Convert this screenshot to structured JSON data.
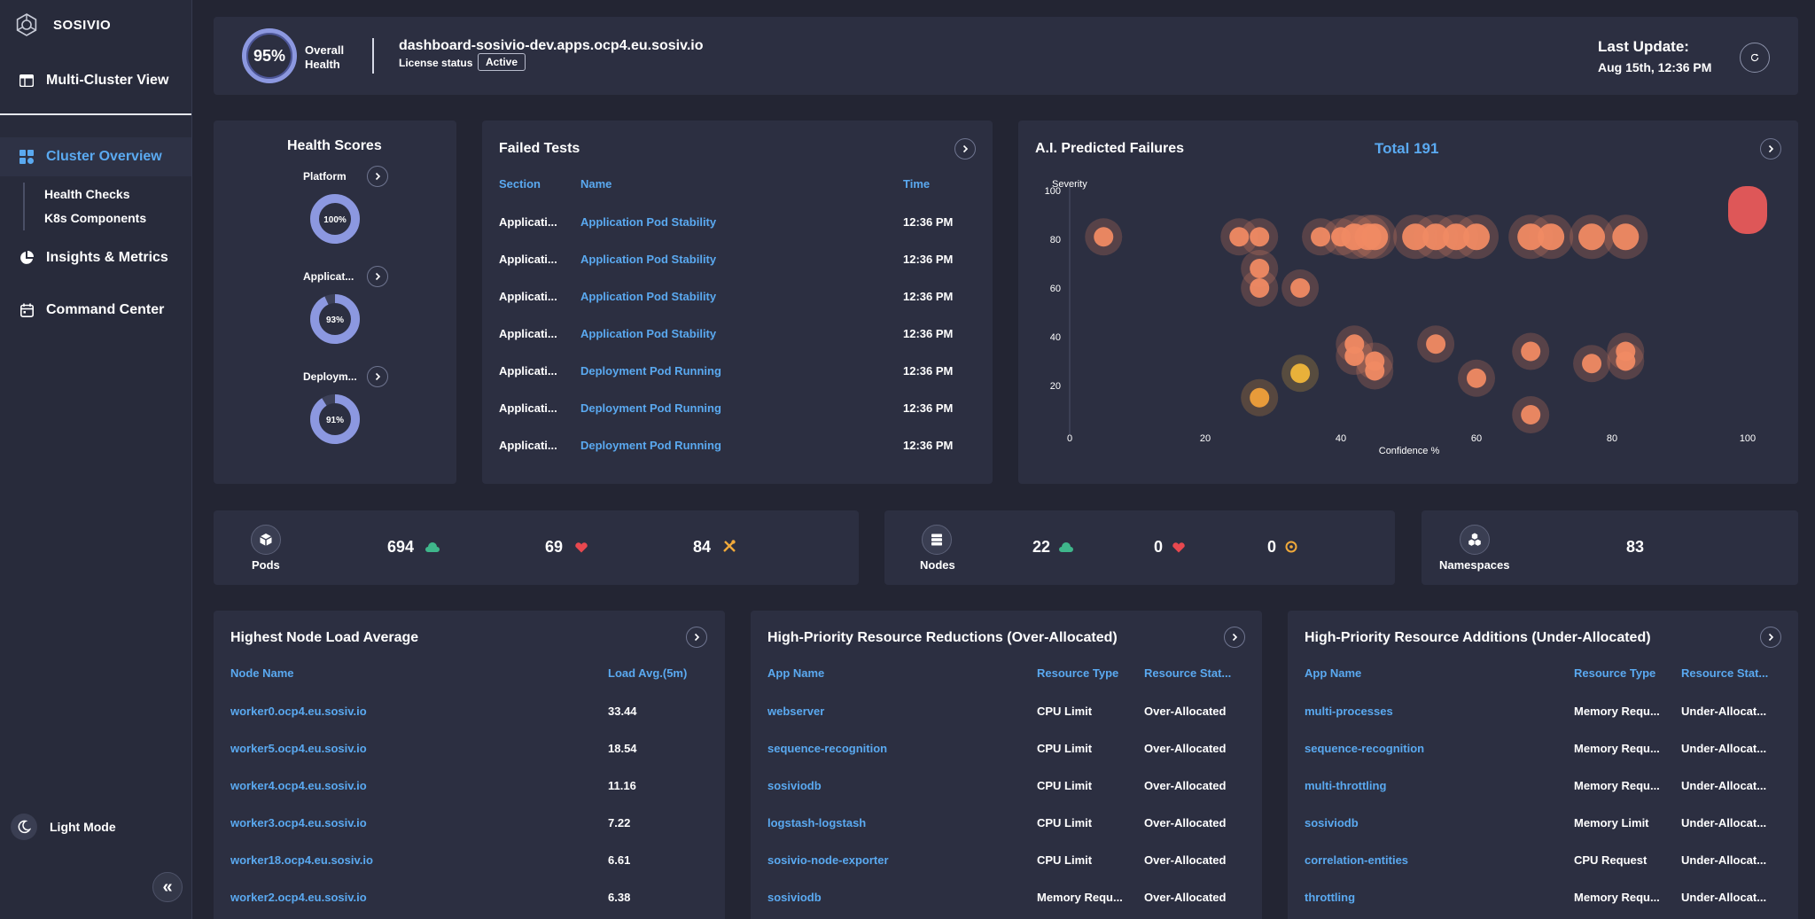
{
  "brand": {
    "name": "SOSIVIO"
  },
  "sidebar": {
    "multi_cluster": "Multi-Cluster View",
    "cluster_overview": "Cluster Overview",
    "sub": [
      "Health Checks",
      "K8s Components"
    ],
    "insights": "Insights & Metrics",
    "command_center": "Command Center",
    "light_mode": "Light Mode",
    "collapse": "«"
  },
  "header": {
    "health_pct": "95%",
    "overall": "Overall",
    "health": "Health",
    "host": "dashboard-sosivio-dev.apps.ocp4.eu.sosiv.io",
    "license_label": "License status",
    "license_value": "Active",
    "last_update_label": "Last Update:",
    "last_update_value": "Aug 15th, 12:36 PM"
  },
  "health_scores": {
    "title": "Health Scores",
    "items": [
      {
        "label": "Platform",
        "value": "100%",
        "pct": 100
      },
      {
        "label": "Applicat...",
        "value": "93%",
        "pct": 93
      },
      {
        "label": "Deploym...",
        "value": "91%",
        "pct": 91
      }
    ]
  },
  "failed_tests": {
    "title": "Failed Tests",
    "columns": [
      "Section",
      "Name",
      "Time"
    ],
    "rows": [
      [
        "Applicati...",
        "Application Pod Stability",
        "12:36 PM"
      ],
      [
        "Applicati...",
        "Application Pod Stability",
        "12:36 PM"
      ],
      [
        "Applicati...",
        "Application Pod Stability",
        "12:36 PM"
      ],
      [
        "Applicati...",
        "Application Pod Stability",
        "12:36 PM"
      ],
      [
        "Applicati...",
        "Deployment Pod Running",
        "12:36 PM"
      ],
      [
        "Applicati...",
        "Deployment Pod Running",
        "12:36 PM"
      ],
      [
        "Applicati...",
        "Deployment Pod Running",
        "12:36 PM"
      ]
    ]
  },
  "ai_failures": {
    "title": "A.I. Predicted Failures",
    "total": "Total 191"
  },
  "chart_data": {
    "type": "scatter",
    "title": "",
    "xlabel": "Confidence %",
    "ylabel": "Severity",
    "xlim": [
      0,
      100
    ],
    "ylim": [
      0,
      100
    ],
    "xticks": [
      "0",
      "20",
      "40",
      "60",
      "80",
      "100"
    ],
    "yticks": [
      "100",
      "80",
      "60",
      "40",
      "20"
    ],
    "series": [
      {
        "color": "#f08a63",
        "points": [
          [
            5,
            81
          ],
          [
            25,
            81
          ],
          [
            28,
            81
          ],
          [
            37,
            81
          ],
          [
            40,
            81
          ],
          [
            42,
            81
          ],
          [
            44,
            81
          ],
          [
            45,
            81
          ],
          [
            51,
            81
          ],
          [
            54,
            81
          ],
          [
            57,
            81
          ],
          [
            60,
            81
          ],
          [
            68,
            81
          ],
          [
            71,
            81
          ],
          [
            77,
            81
          ],
          [
            82,
            81
          ],
          [
            28,
            68
          ],
          [
            28,
            60
          ],
          [
            34,
            60
          ],
          [
            42,
            37
          ],
          [
            42,
            32
          ],
          [
            45,
            30
          ],
          [
            45,
            26
          ],
          [
            54,
            37
          ],
          [
            60,
            23
          ],
          [
            68,
            34
          ],
          [
            68,
            8
          ],
          [
            77,
            29
          ],
          [
            82,
            34
          ],
          [
            82,
            30
          ]
        ]
      },
      {
        "color": "#f0b63a",
        "points": [
          [
            34,
            25
          ]
        ]
      },
      {
        "color": "#f0a03a",
        "points": [
          [
            28,
            15
          ]
        ]
      },
      {
        "color": "#e85a5a",
        "points": [
          [
            100,
            92
          ]
        ]
      }
    ]
  },
  "stats": {
    "pods": {
      "label": "Pods",
      "up": "694",
      "down": "69",
      "warn": "84"
    },
    "nodes": {
      "label": "Nodes",
      "up": "22",
      "down": "0",
      "warn": "0"
    },
    "namespaces": {
      "label": "Namespaces",
      "count": "83"
    }
  },
  "node_load": {
    "title": "Highest Node Load Average",
    "columns": [
      "Node Name",
      "Load Avg.(5m)"
    ],
    "rows": [
      [
        "worker0.ocp4.eu.sosiv.io",
        "33.44"
      ],
      [
        "worker5.ocp4.eu.sosiv.io",
        "18.54"
      ],
      [
        "worker4.ocp4.eu.sosiv.io",
        "11.16"
      ],
      [
        "worker3.ocp4.eu.sosiv.io",
        "7.22"
      ],
      [
        "worker18.ocp4.eu.sosiv.io",
        "6.61"
      ],
      [
        "worker2.ocp4.eu.sosiv.io",
        "6.38"
      ]
    ]
  },
  "reductions": {
    "title": "High-Priority Resource Reductions (Over-Allocated)",
    "columns": [
      "App Name",
      "Resource Type",
      "Resource Stat..."
    ],
    "rows": [
      [
        "webserver",
        "CPU Limit",
        "Over-Allocated"
      ],
      [
        "sequence-recognition",
        "CPU Limit",
        "Over-Allocated"
      ],
      [
        "sosiviodb",
        "CPU Limit",
        "Over-Allocated"
      ],
      [
        "logstash-logstash",
        "CPU Limit",
        "Over-Allocated"
      ],
      [
        "sosivio-node-exporter",
        "CPU Limit",
        "Over-Allocated"
      ],
      [
        "sosiviodb",
        "Memory Requ...",
        "Over-Allocated"
      ]
    ]
  },
  "additions": {
    "title": "High-Priority Resource Additions (Under-Allocated)",
    "columns": [
      "App Name",
      "Resource Type",
      "Resource Stat..."
    ],
    "rows": [
      [
        "multi-processes",
        "Memory Requ...",
        "Under-Allocat..."
      ],
      [
        "sequence-recognition",
        "Memory Requ...",
        "Under-Allocat..."
      ],
      [
        "multi-throttling",
        "Memory Requ...",
        "Under-Allocat..."
      ],
      [
        "sosiviodb",
        "Memory Limit",
        "Under-Allocat..."
      ],
      [
        "correlation-entities",
        "CPU Request",
        "Under-Allocat..."
      ],
      [
        "throttling",
        "Memory Requ...",
        "Under-Allocat..."
      ]
    ]
  },
  "colors": {
    "accent": "#5aa9f0",
    "up": "#3fb68b",
    "down": "#e8484f",
    "warn": "#f0a93a"
  }
}
